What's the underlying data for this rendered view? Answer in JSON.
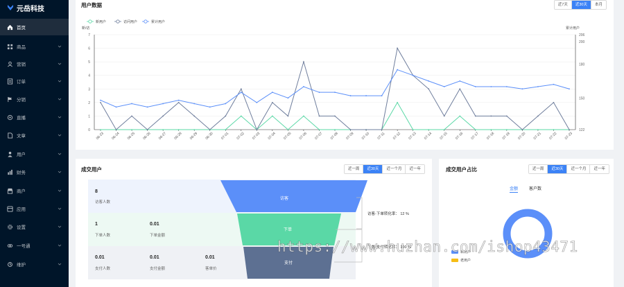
{
  "brand": {
    "name": "元岳科技"
  },
  "sidebar": {
    "items": [
      {
        "label": "首页",
        "icon": "home-icon",
        "active": true
      },
      {
        "label": "商品",
        "icon": "grid-icon"
      },
      {
        "label": "营销",
        "icon": "user-icon"
      },
      {
        "label": "订单",
        "icon": "order-icon"
      },
      {
        "label": "分销",
        "icon": "flag-icon"
      },
      {
        "label": "直播",
        "icon": "live-icon"
      },
      {
        "label": "文章",
        "icon": "doc-icon"
      },
      {
        "label": "用户",
        "icon": "person-icon"
      },
      {
        "label": "财务",
        "icon": "chart-icon"
      },
      {
        "label": "商户",
        "icon": "shop-icon"
      },
      {
        "label": "应用",
        "icon": "app-icon"
      },
      {
        "label": "设置",
        "icon": "gear-icon"
      },
      {
        "label": "一号通",
        "icon": "link-icon"
      },
      {
        "label": "维护",
        "icon": "tool-icon"
      }
    ]
  },
  "user_chart": {
    "title": "用户数据",
    "range_options": [
      "近7天",
      "近30天",
      "本月"
    ],
    "range_selected": 1
  },
  "chart_data": {
    "type": "line",
    "categories": [
      "06-23",
      "06-24",
      "06-25",
      "06-26",
      "06-27",
      "06-28",
      "06-29",
      "06-30",
      "07-01",
      "07-02",
      "07-03",
      "07-04",
      "07-05",
      "07-06",
      "07-07",
      "07-08",
      "07-09",
      "07-10",
      "07-11",
      "07-12",
      "07-13",
      "07-14",
      "07-15",
      "07-16",
      "07-17",
      "07-18",
      "07-19",
      "07-20",
      "07-21",
      "07-22",
      "07-23"
    ],
    "legend": [
      "新用户",
      "访问用户",
      "累计用户"
    ],
    "left_axis": {
      "label": "新/访",
      "min": 0,
      "max": 7,
      "ticks": [
        0,
        1,
        2,
        3,
        4,
        5,
        6,
        7
      ]
    },
    "right_axis": {
      "label": "累计用户",
      "min": 122,
      "max": 206,
      "ticks": [
        122,
        150,
        180,
        200,
        206
      ]
    },
    "series": [
      {
        "name": "新用户",
        "axis": "left",
        "color": "#5ad8a6",
        "values": [
          0,
          0,
          0,
          0,
          0,
          0,
          0,
          0,
          0,
          1,
          0,
          1,
          0,
          1,
          0,
          0,
          0,
          0,
          0,
          2,
          0,
          0,
          0,
          1,
          0,
          0,
          0,
          0,
          0,
          0,
          0
        ]
      },
      {
        "name": "访问用户",
        "axis": "left",
        "color": "#6e7d9c",
        "values": [
          2,
          0,
          1,
          0,
          1,
          2,
          1,
          0,
          1,
          3,
          0,
          2,
          1,
          5,
          1,
          1,
          0,
          0,
          0,
          6,
          4,
          3,
          1,
          3,
          1,
          1,
          1,
          0,
          1,
          2,
          0
        ]
      },
      {
        "name": "累计用户",
        "axis": "right",
        "color": "#5b8ff9",
        "values": [
          148,
          142,
          145,
          142,
          145,
          148,
          145,
          142,
          145,
          155,
          146,
          155,
          150,
          160,
          155,
          155,
          152,
          152,
          152,
          175,
          170,
          165,
          160,
          165,
          160,
          160,
          160,
          158,
          160,
          162,
          158
        ]
      }
    ]
  },
  "deal_users": {
    "title": "成交用户",
    "range_options": [
      "近一周",
      "近30天",
      "近一个月",
      "近一年"
    ],
    "range_selected": 1,
    "rows": [
      {
        "stats": [
          {
            "value": "8",
            "label": "访客人数"
          }
        ],
        "stage": "访客"
      },
      {
        "stats": [
          {
            "value": "1",
            "label": "下单人数"
          },
          {
            "value": "0.01",
            "label": "下单金额"
          }
        ],
        "stage": "下单"
      },
      {
        "stats": [
          {
            "value": "0.01",
            "label": "支付人数"
          },
          {
            "value": "0.01",
            "label": "支付金额"
          },
          {
            "value": "0.01",
            "label": "客单价"
          }
        ],
        "stage": "支付"
      }
    ],
    "conversions": [
      {
        "label": "访客-下单转化率：",
        "value": "12 %"
      },
      {
        "label": "下单-支付转化率：",
        "value": "100 %"
      }
    ]
  },
  "ratio": {
    "title": "成交用户占比",
    "range_options": [
      "近一周",
      "近30天",
      "近一个月",
      "近一年"
    ],
    "range_selected": 1,
    "tabs": [
      "金额",
      "客户数"
    ],
    "tab_selected": 0,
    "legend": [
      {
        "label": "新用户",
        "color": "#5b8ff9"
      },
      {
        "label": "老用户",
        "color": "#f6bd16"
      }
    ]
  },
  "watermark": "https://www.huzhan.com/ishop43471"
}
